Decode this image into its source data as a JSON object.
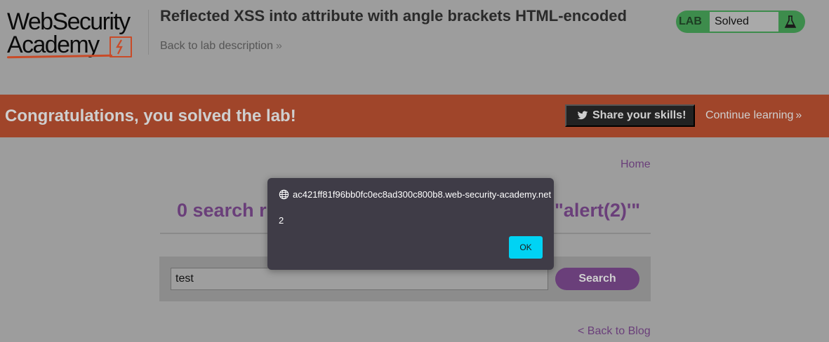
{
  "logo": {
    "line1": "WebSecurity",
    "line2": "Academy"
  },
  "header": {
    "title": "Reflected XSS into attribute with angle brackets HTML-encoded",
    "back_link": "Back to lab description",
    "chevron": "»",
    "lab_tag": "LAB",
    "lab_status": "Solved",
    "lab_icon": "flask-icon"
  },
  "banner": {
    "message": "Congratulations, you solved the lab!",
    "share_label": "Share your skills!",
    "share_icon": "twitter-icon",
    "continue_label": "Continue learning",
    "chevron": "»"
  },
  "content": {
    "home_link": "Home",
    "results_heading_visible_start": "0 search r",
    "results_heading_visible_end": "\"alert(2)'\"",
    "search_value": "test",
    "search_button": "Search",
    "back_to_blog": "< Back to Blog"
  },
  "dialog": {
    "origin": "ac421ff81f96bb0fc0ec8ad300c800b8.web-security-academy.net",
    "origin_icon": "globe-icon",
    "message": "2",
    "ok_label": "OK"
  },
  "colors": {
    "banner": "#a0452a",
    "accent_purple": "#6a3f7a",
    "status_green": "#3d8c4c",
    "dialog_bg": "#3f3c47",
    "ok_button": "#00d3f4"
  }
}
